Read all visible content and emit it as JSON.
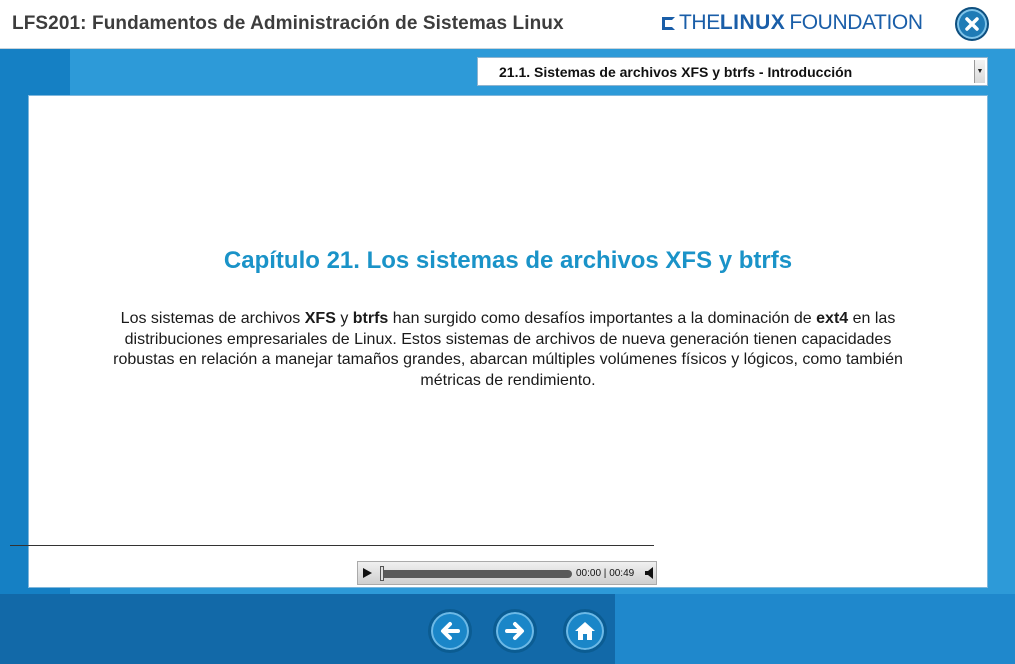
{
  "header": {
    "title": "LFS201: Fundamentos de Administración de Sistemas Linux",
    "brand": {
      "the": "THE",
      "linux": "LINUX",
      "foundation": "FOUNDATION"
    },
    "close_icon": "close-icon"
  },
  "section_select": {
    "selected": "21.1. Sistemas de archivos XFS y btrfs - Introducción"
  },
  "content": {
    "chapter_title": "Capítulo 21. Los sistemas de archivos XFS y btrfs",
    "paragraph": {
      "t1": "Los sistemas de archivos ",
      "b1": "XFS",
      "t2": " y ",
      "b2": "btrfs",
      "t3": " han surgido como desafíos importantes a la dominación de ",
      "b3": "ext4",
      "t4": " en las distribuciones empresariales de Linux. Estos sistemas de archivos de nueva generación tienen capacidades robustas en relación a manejar tamaños grandes, abarcan múltiples volúmenes físicos y lógicos, como también métricas de rendimiento."
    }
  },
  "audio_player": {
    "current_time": "00:00",
    "separator": " | ",
    "duration": "00:49",
    "progress": 0
  },
  "navigation": {
    "back_icon": "arrow-left-icon",
    "next_icon": "arrow-right-icon",
    "home_icon": "home-icon"
  },
  "colors": {
    "accent": "#1a93c8",
    "background_blue": "#1a86c8",
    "brand_blue": "#1a5ea8"
  }
}
